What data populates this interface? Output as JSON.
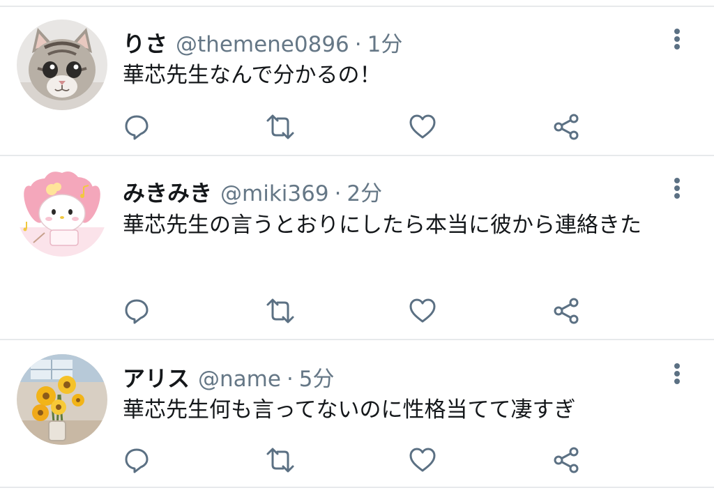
{
  "colors": {
    "text_primary": "#14171a",
    "text_secondary": "#657786",
    "icon": "#5b7083",
    "divider": "#e7e9eb"
  },
  "tweets": [
    {
      "display_name": "りさ",
      "handle": "@themene0896",
      "separator": "·",
      "time": "1分",
      "text": "華芯先生なんで分かるの！",
      "avatar_icon": "kitten-avatar"
    },
    {
      "display_name": "みきみき",
      "handle": "@miki369",
      "separator": "·",
      "time": "2分",
      "text": "華芯先生の言うとおりにしたら本当に彼から連絡きた",
      "avatar_icon": "my-melody-avatar"
    },
    {
      "display_name": "アリス",
      "handle": "@name",
      "separator": "·",
      "time": "5分",
      "text": "華芯先生何も言ってないのに性格当てて凄すぎ",
      "avatar_icon": "sunflower-vase-avatar"
    }
  ],
  "actions": [
    "reply-icon",
    "retweet-icon",
    "like-icon",
    "share-icon"
  ]
}
